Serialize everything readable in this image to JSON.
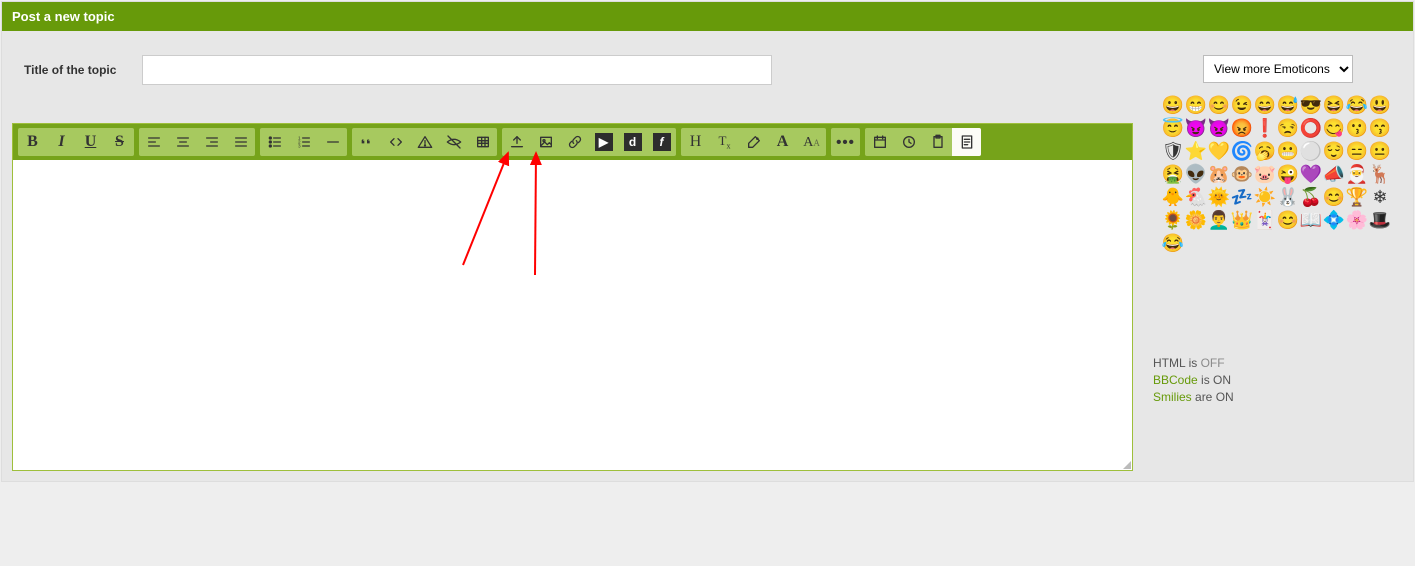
{
  "panel": {
    "title": "Post a new topic"
  },
  "title_field": {
    "label": "Title of the topic",
    "placeholder": "",
    "value": ""
  },
  "toolbar": {
    "groups": [
      [
        {
          "name": "bold",
          "title": "Bold"
        },
        {
          "name": "italic",
          "title": "Italic"
        },
        {
          "name": "underline",
          "title": "Underline"
        },
        {
          "name": "strike",
          "title": "Strikethrough"
        }
      ],
      [
        {
          "name": "align-left",
          "title": "Align left"
        },
        {
          "name": "align-center",
          "title": "Align center"
        },
        {
          "name": "align-right",
          "title": "Align right"
        },
        {
          "name": "align-justify",
          "title": "Justify"
        }
      ],
      [
        {
          "name": "ul",
          "title": "Unordered list"
        },
        {
          "name": "ol",
          "title": "Ordered list"
        },
        {
          "name": "hr",
          "title": "Horizontal rule"
        }
      ],
      [
        {
          "name": "quote",
          "title": "Quote"
        },
        {
          "name": "code",
          "title": "Code"
        },
        {
          "name": "spoiler",
          "title": "Spoiler"
        },
        {
          "name": "hidden",
          "title": "Hidden"
        },
        {
          "name": "table",
          "title": "Table"
        }
      ],
      [
        {
          "name": "upload",
          "title": "Upload image"
        },
        {
          "name": "image",
          "title": "Insert image"
        },
        {
          "name": "link",
          "title": "Insert link"
        },
        {
          "name": "youtube",
          "title": "YouTube"
        },
        {
          "name": "dailymotion",
          "title": "Dailymotion"
        },
        {
          "name": "flash",
          "title": "Flash"
        }
      ],
      [
        {
          "name": "heading",
          "title": "Headers"
        },
        {
          "name": "sup-sub",
          "title": "Superscript/Subscript"
        },
        {
          "name": "color-picker",
          "title": "Font color"
        },
        {
          "name": "font",
          "title": "Font"
        },
        {
          "name": "font-size",
          "title": "Font size"
        }
      ],
      [
        {
          "name": "more",
          "title": "More"
        }
      ],
      [
        {
          "name": "date",
          "title": "Date"
        },
        {
          "name": "time",
          "title": "Time"
        },
        {
          "name": "paste",
          "title": "Paste"
        },
        {
          "name": "source",
          "title": "Toggle source"
        }
      ]
    ]
  },
  "emoticons": {
    "dropdown_label": "View more Emoticons",
    "list": [
      "😀",
      "😁",
      "😊",
      "😉",
      "😄",
      "😅",
      "😎",
      "😆",
      "😂",
      "😃",
      "😇",
      "😈",
      "👿",
      "😡",
      "❗",
      "😒",
      "⭕",
      "😋",
      "😗",
      "😙",
      "🛡",
      "⭐",
      "💛",
      "🌀",
      "🥱",
      "😬",
      "⚪",
      "😌",
      "😑",
      "😐",
      "🤮",
      "👽",
      "🐹",
      "🐵",
      "🐷",
      "😜",
      "💜",
      "📣",
      "🎅",
      "🦌",
      "🐥",
      "🐔",
      "🌞",
      "💤",
      "☀️",
      "🐰",
      "🍒",
      "😊",
      "🏆",
      "❄",
      "🌻",
      "🌼",
      "👨‍🦱",
      "👑",
      "🃏",
      "😊",
      "📖",
      "💠",
      "🌸",
      "🎩",
      "😂"
    ]
  },
  "status": {
    "lines": [
      {
        "label": "HTML",
        "text": "is",
        "state": "OFF"
      },
      {
        "label": "BBCode",
        "text": "is",
        "state": "ON",
        "link": true
      },
      {
        "label": "Smilies",
        "text": "are",
        "state": "ON",
        "link": true
      }
    ]
  }
}
